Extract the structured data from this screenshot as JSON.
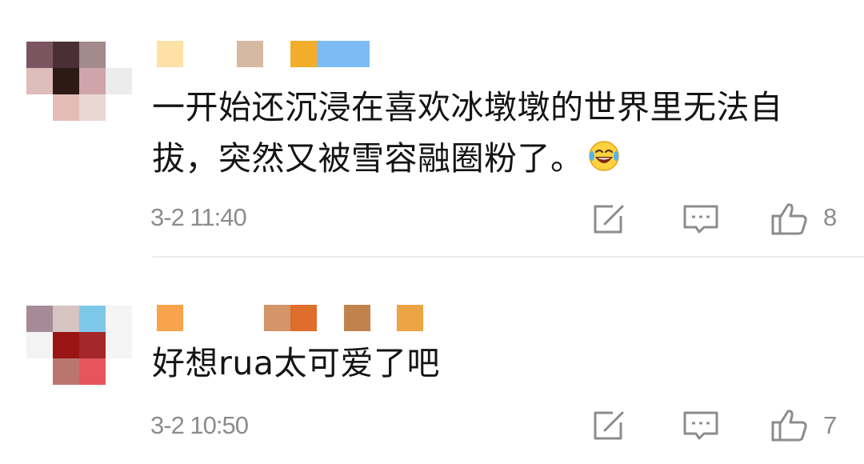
{
  "comments": [
    {
      "text": "一开始还沉浸在喜欢冰墩墩的世界里无法自拔，突然又被雪容融圈粉了。",
      "emoji": "laughing-tears-icon",
      "time": "3-2 11:40",
      "likes": "8",
      "avatar_colors": [
        "#7a5560",
        "#4a3034",
        "#a38a8d",
        "#ffffff",
        "#ddbcb9",
        "#2d1a14",
        "#cfa4aa",
        "#ececec",
        "#ffffff",
        "#e4bdb8",
        "#ead6d2",
        "#ffffff"
      ],
      "name_colors": [
        "#fde1a7",
        "#d6b9a1",
        "#f4ad2a",
        "#7dbbf5"
      ]
    },
    {
      "text": "好想rua太可爱了吧",
      "emoji": "",
      "time": "3-2 10:50",
      "likes": "7",
      "avatar_colors": [
        "#a78a98",
        "#d5c4c2",
        "#7ec8ea",
        "#f5f5f5",
        "#f3f3f3",
        "#9a1414",
        "#a4272a",
        "#f5f5f5",
        "#ffffff",
        "#bb7570",
        "#e4565c",
        "#ffffff"
      ],
      "name_colors": [
        "#f9a44d",
        "#d39468",
        "#df6d2c",
        "#c2824d",
        "#eda444"
      ]
    }
  ],
  "icons": {
    "share": "share-edit-icon",
    "reply": "comment-reply-icon",
    "like": "thumbs-up-icon"
  },
  "colors": {
    "text": "#141414",
    "meta": "#8c8c8c",
    "divider": "#ececec"
  }
}
